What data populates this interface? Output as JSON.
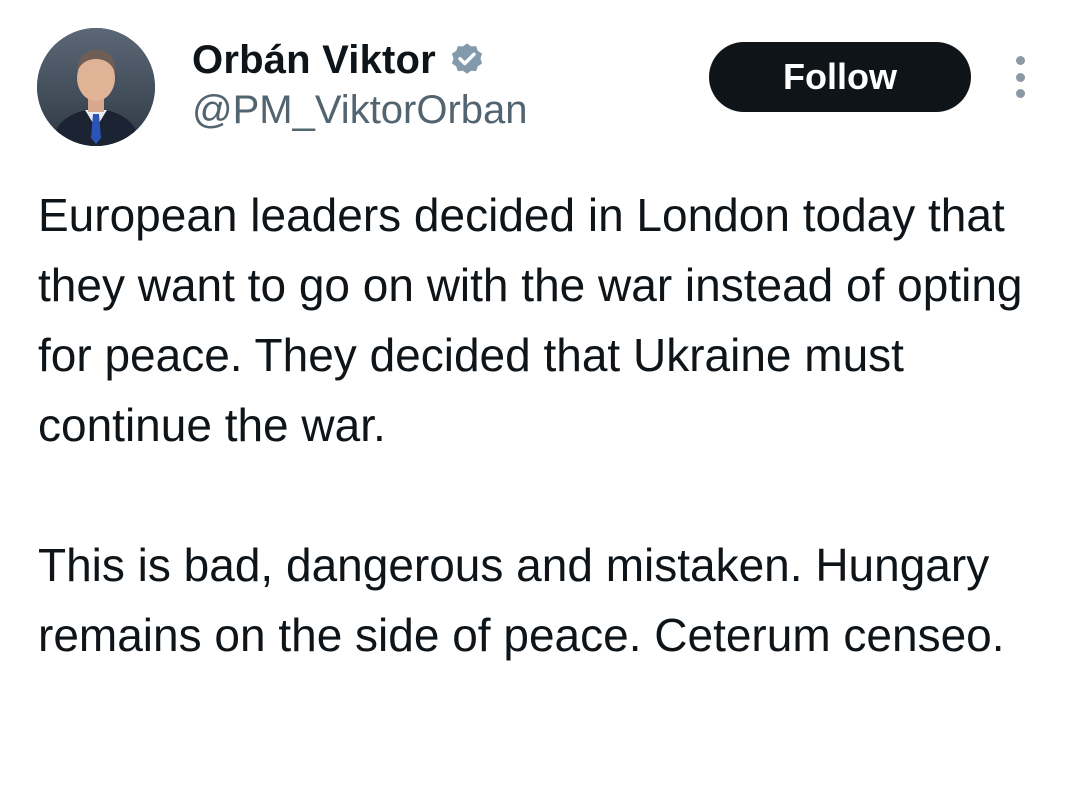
{
  "author": {
    "display_name": "Orbán Viktor",
    "handle": "@PM_ViktorOrban",
    "verified_icon": "verified-badge-icon",
    "verified_color": "#829aab"
  },
  "actions": {
    "follow_label": "Follow",
    "more_icon": "more-vertical-icon"
  },
  "tweet": {
    "paragraphs": [
      "European leaders decided in London today that they want to go on with the war instead of opting for peace. They decided that Ukraine must continue the war.",
      "This is bad, dangerous and mistaken. Hungary remains on the side of peace. Ceterum censeo."
    ]
  },
  "colors": {
    "text": "#0f1419",
    "secondary_text": "#536471",
    "follow_bg": "#0f1419",
    "follow_text": "#ffffff"
  }
}
